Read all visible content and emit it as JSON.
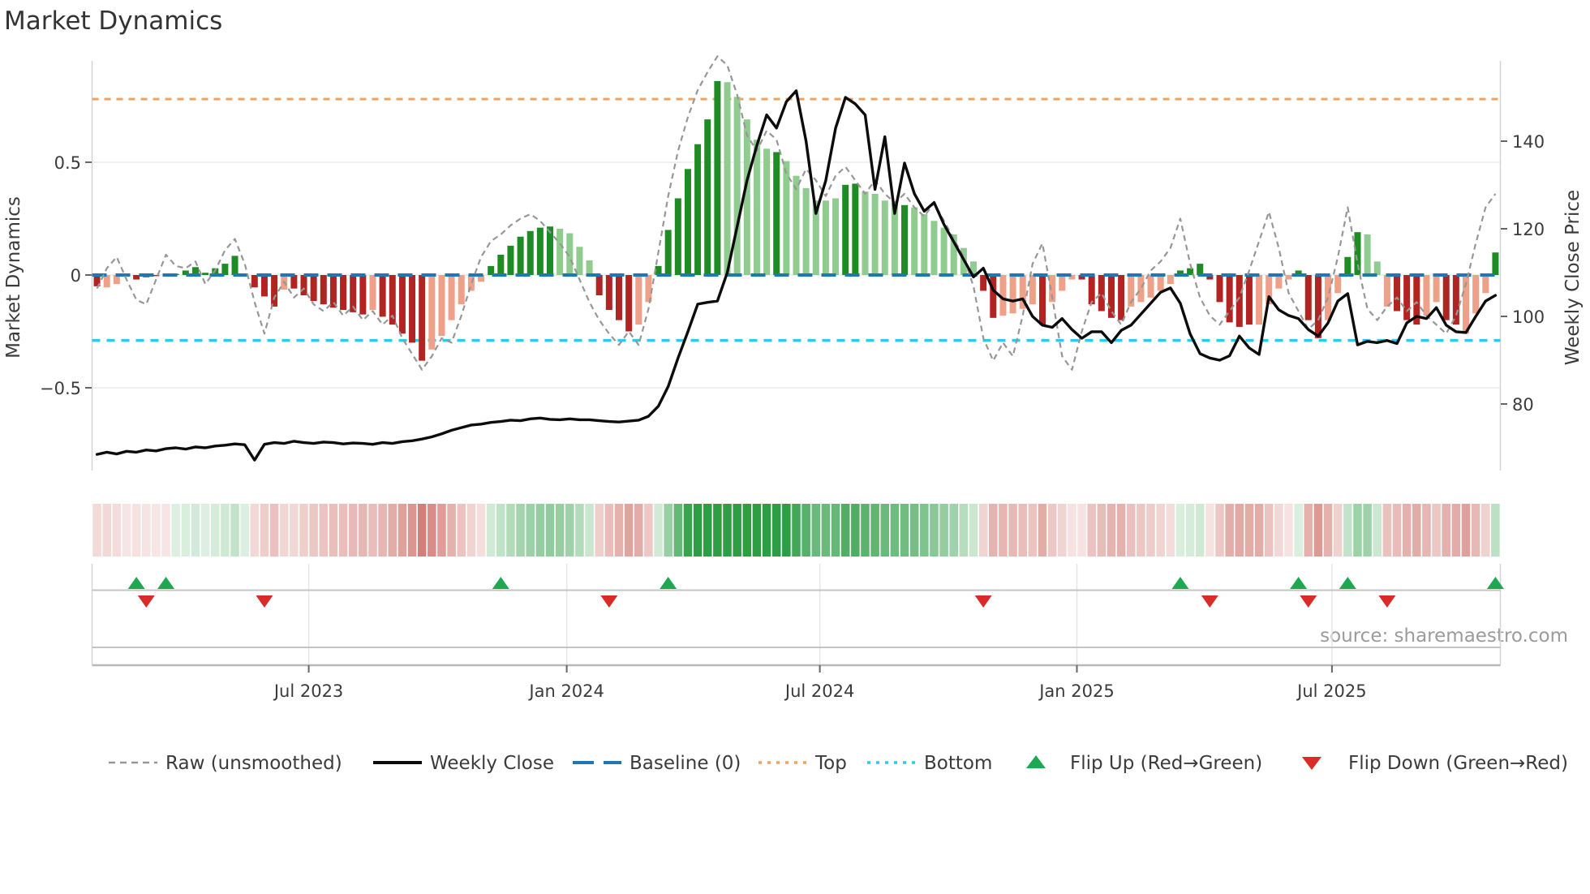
{
  "page": {
    "title": "Market Dynamics"
  },
  "chart": {
    "y_left": {
      "label": "Market Dynamics",
      "tick_labels": [
        "0.5",
        "0",
        "−0.5"
      ],
      "tick_values": [
        0.5,
        0,
        -0.5
      ]
    },
    "y_right": {
      "label": "Weekly Close Price",
      "tick_labels": [
        "140",
        "120",
        "100",
        "80"
      ],
      "tick_values": [
        140,
        120,
        100,
        80
      ]
    },
    "x_ticks": [
      "Jul 2023",
      "Jan 2024",
      "Jul 2024",
      "Jan 2025",
      "Jul 2025"
    ],
    "source": "source: sharemaestro.com",
    "colors": {
      "bar_dark_red": "#b22421",
      "bar_light_red": "#efa088",
      "bar_dark_green": "#1f8b24",
      "bar_light_green": "#90cb90",
      "baseline_blue": "#2077b4",
      "top_orange": "#f0a35e",
      "bottom_cyan": "#2ec9ec",
      "raw_gray": "#979797",
      "close_black": "#0c0c0c",
      "flip_up_green": "#1da851",
      "flip_down_red": "#d92b28",
      "heat_green": "#2e9e45",
      "heat_red": "#c85f57",
      "grid": "#ebebeb",
      "spine": "#d5d5d5"
    },
    "legend": [
      {
        "type": "dashed-line",
        "color_key": "raw_gray",
        "label": "Raw (unsmoothed)"
      },
      {
        "type": "solid-line",
        "color_key": "close_black",
        "label": "Weekly Close"
      },
      {
        "type": "dashed-line-long",
        "color_key": "baseline_blue",
        "label": "Baseline (0)"
      },
      {
        "type": "dotted-line",
        "color_key": "top_orange",
        "label": "Top"
      },
      {
        "type": "dotted-line",
        "color_key": "bottom_cyan",
        "label": "Bottom"
      },
      {
        "type": "triangle-up",
        "color_key": "flip_up_green",
        "label": "Flip Up (Red→Green)"
      },
      {
        "type": "triangle-down",
        "color_key": "flip_down_red",
        "label": "Flip Down (Green→Red)"
      }
    ]
  },
  "chart_data": {
    "type": "combo: weekly bar oscillator + raw dashed line + weekly close price line + regime heatmap + flip markers",
    "weeks": 143,
    "baseline": 0,
    "top_threshold": 0.78,
    "bottom_threshold": -0.29,
    "ylim_left": [
      -0.88,
      0.95
    ],
    "ylim_right": [
      64.8,
      158.3
    ],
    "x_tick_weeks": [
      22.0,
      48.2,
      73.9,
      100.0,
      125.9
    ],
    "bar_shade_legend": "R=dark red, r=light red/salmon, G=dark green, g=light green",
    "bar_shades": "RrrrRRRRGGGGGGGGRRRrRRRRRRRRrRRRRRrrrrrrGGGGGGGggggRRRRrrGGGGGGGgggggGggggggGGggggGgggggggRRrrrrRrrrRRRRRrrrrrGGGRRRRRrrrrGRRrrGGggrRRRrrRRrrrG",
    "bars": [
      -0.05,
      -0.055,
      -0.04,
      -0.005,
      -0.02,
      -0.01,
      -0.005,
      -0.005,
      0.005,
      0.02,
      0.035,
      0.01,
      0.03,
      0.05,
      0.085,
      0.005,
      -0.055,
      -0.095,
      -0.14,
      -0.065,
      -0.06,
      -0.09,
      -0.115,
      -0.13,
      -0.145,
      -0.155,
      -0.165,
      -0.175,
      -0.155,
      -0.185,
      -0.22,
      -0.26,
      -0.3,
      -0.38,
      -0.33,
      -0.27,
      -0.2,
      -0.13,
      -0.07,
      -0.03,
      0.04,
      0.09,
      0.13,
      0.17,
      0.195,
      0.21,
      0.215,
      0.205,
      0.185,
      0.125,
      0.065,
      -0.09,
      -0.155,
      -0.2,
      -0.25,
      -0.22,
      -0.12,
      0.04,
      0.2,
      0.34,
      0.47,
      0.58,
      0.69,
      0.86,
      0.855,
      0.79,
      0.69,
      0.6,
      0.56,
      0.545,
      0.505,
      0.44,
      0.385,
      0.33,
      0.33,
      0.34,
      0.4,
      0.405,
      0.37,
      0.36,
      0.33,
      0.32,
      0.31,
      0.3,
      0.27,
      0.24,
      0.21,
      0.18,
      0.12,
      0.06,
      -0.07,
      -0.19,
      -0.18,
      -0.17,
      -0.15,
      -0.13,
      -0.22,
      -0.12,
      -0.07,
      -0.02,
      -0.02,
      -0.13,
      -0.16,
      -0.19,
      -0.2,
      -0.14,
      -0.12,
      -0.1,
      -0.07,
      -0.04,
      0.02,
      0.03,
      0.05,
      -0.02,
      -0.12,
      -0.21,
      -0.23,
      -0.22,
      -0.22,
      -0.13,
      -0.06,
      -0.02,
      0.02,
      -0.2,
      -0.28,
      -0.2,
      -0.08,
      0.08,
      0.19,
      0.18,
      0.06,
      -0.14,
      -0.16,
      -0.2,
      -0.22,
      -0.18,
      -0.12,
      -0.2,
      -0.22,
      -0.26,
      -0.17,
      -0.08,
      0.1
    ],
    "raw": [
      -0.06,
      0.03,
      0.08,
      -0.02,
      -0.11,
      -0.13,
      -0.02,
      0.09,
      0.04,
      0.03,
      0.06,
      -0.04,
      0.02,
      0.11,
      0.16,
      0.05,
      -0.12,
      -0.26,
      -0.1,
      -0.03,
      -0.1,
      -0.06,
      -0.13,
      -0.16,
      -0.12,
      -0.18,
      -0.14,
      -0.2,
      -0.16,
      -0.22,
      -0.18,
      -0.28,
      -0.35,
      -0.42,
      -0.36,
      -0.28,
      -0.3,
      -0.18,
      -0.04,
      0.08,
      0.15,
      0.18,
      0.22,
      0.25,
      0.27,
      0.24,
      0.19,
      0.14,
      0.08,
      -0.02,
      -0.12,
      -0.2,
      -0.26,
      -0.31,
      -0.25,
      -0.31,
      -0.15,
      0.1,
      0.35,
      0.55,
      0.7,
      0.82,
      0.9,
      0.97,
      0.93,
      0.8,
      0.62,
      0.55,
      0.64,
      0.6,
      0.45,
      0.38,
      0.47,
      0.42,
      0.35,
      0.44,
      0.48,
      0.42,
      0.36,
      0.42,
      0.36,
      0.32,
      0.36,
      0.3,
      0.26,
      0.32,
      0.24,
      0.16,
      0.08,
      -0.05,
      -0.28,
      -0.38,
      -0.3,
      -0.36,
      -0.18,
      0.05,
      0.14,
      -0.1,
      -0.36,
      -0.42,
      -0.25,
      -0.12,
      -0.08,
      -0.16,
      -0.22,
      -0.12,
      -0.06,
      0.02,
      0.06,
      0.12,
      0.25,
      0.05,
      -0.1,
      -0.18,
      -0.22,
      -0.16,
      -0.1,
      0.02,
      0.15,
      0.28,
      0.12,
      -0.08,
      -0.16,
      -0.24,
      -0.2,
      -0.1,
      0.08,
      0.3,
      0.05,
      -0.15,
      -0.2,
      -0.14,
      -0.1,
      -0.16,
      -0.12,
      -0.18,
      -0.22,
      -0.26,
      -0.18,
      -0.04,
      0.14,
      0.3,
      0.36
    ],
    "close": [
      68.5,
      69,
      68.6,
      69.2,
      69,
      69.5,
      69.3,
      69.8,
      70,
      69.7,
      70.2,
      70,
      70.4,
      70.6,
      70.9,
      70.7,
      67.2,
      70.8,
      71.2,
      71,
      71.5,
      71.2,
      71,
      71.3,
      71.2,
      70.9,
      71.1,
      71,
      70.8,
      71.2,
      71,
      71.4,
      71.6,
      72,
      72.5,
      73.2,
      74,
      74.6,
      75.2,
      75.4,
      75.8,
      76,
      76.3,
      76.2,
      76.6,
      76.8,
      76.5,
      76.4,
      76.6,
      76.4,
      76.4,
      76.2,
      76,
      75.9,
      76.1,
      76.3,
      77.2,
      79.5,
      84,
      90.5,
      96.5,
      102.8,
      103.2,
      103.5,
      110,
      120.5,
      131,
      139,
      146,
      143,
      149,
      151.5,
      140,
      123.5,
      131,
      143,
      150,
      148.5,
      146,
      129,
      141,
      123.5,
      135,
      128,
      124,
      126,
      121,
      117,
      113,
      109,
      111,
      106,
      104,
      103.5,
      104,
      100,
      98,
      97.5,
      99.5,
      97,
      95,
      96.5,
      96.5,
      94,
      96.8,
      98,
      100.5,
      103,
      105.5,
      106.5,
      103,
      96,
      91.5,
      90.5,
      90,
      91,
      95.5,
      92.8,
      91.3,
      104.5,
      101.5,
      100.2,
      99.5,
      97,
      95.5,
      98.5,
      103.5,
      105.2,
      93.5,
      94.3,
      94,
      94.5,
      93.8,
      98.5,
      100,
      99.5,
      102,
      98,
      96.5,
      96.3,
      100,
      103.5,
      104.8
    ],
    "flip_up_weeks": [
      4,
      7,
      41,
      58,
      110,
      122,
      127,
      142
    ],
    "flip_down_weeks": [
      5,
      17,
      52,
      90,
      113,
      123,
      131
    ],
    "heatmap": "derived: sign of bars gives green/red hue, |bar| gives intensity"
  }
}
